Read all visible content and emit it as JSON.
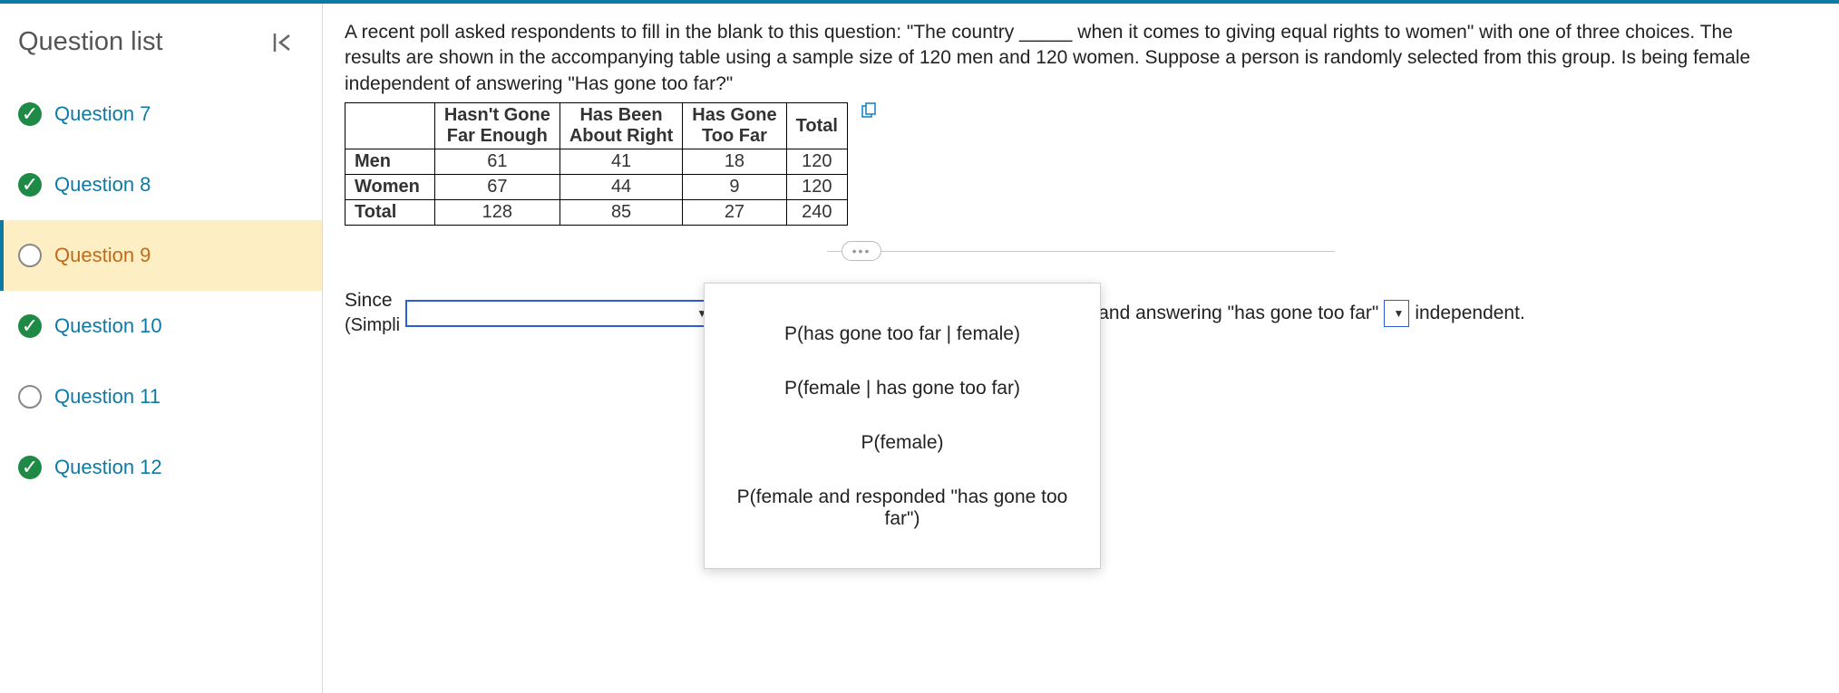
{
  "sidebar": {
    "title": "Question list",
    "items": [
      {
        "label": "Question 7",
        "status": "done"
      },
      {
        "label": "Question 8",
        "status": "done"
      },
      {
        "label": "Question 9",
        "status": "open",
        "active": true
      },
      {
        "label": "Question 10",
        "status": "done"
      },
      {
        "label": "Question 11",
        "status": "open"
      },
      {
        "label": "Question 12",
        "status": "done"
      }
    ]
  },
  "prompt": "A recent poll asked respondents to fill in the blank to this question: \"The country _____ when it comes to giving equal rights to women\" with one of three choices. The results are shown in the accompanying table using a sample size of 120 men and 120 women. Suppose a person is randomly selected from this group. Is being female independent of answering \"Has gone too far?\"",
  "table": {
    "col_headers": [
      "Hasn't Gone\nFar Enough",
      "Has Been\nAbout Right",
      "Has Gone\nToo Far",
      "Total"
    ],
    "rows": [
      {
        "label": "Men",
        "cells": [
          "61",
          "41",
          "18",
          "120"
        ]
      },
      {
        "label": "Women",
        "cells": [
          "67",
          "44",
          "9",
          "120"
        ]
      },
      {
        "label": "Total",
        "cells": [
          "128",
          "85",
          "27",
          "240"
        ]
      }
    ]
  },
  "answer": {
    "since": "Since",
    "simplify": "(Simpli",
    "eq": "=",
    "and": "and",
    "mid": "the events \"female\" and answering \"has gone too far\"",
    "tail": "independent.",
    "val1": "",
    "val2": ""
  },
  "dropdown_options": [
    "P(has gone too far | female)",
    "P(female | has gone too far)",
    "P(female)",
    "P(female and responded \"has gone too far\")"
  ],
  "glyphs": {
    "tri": "▼",
    "check": "✓",
    "dots": "•••"
  }
}
